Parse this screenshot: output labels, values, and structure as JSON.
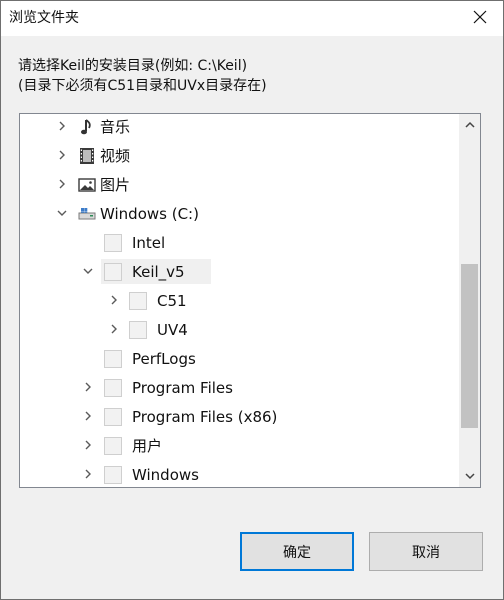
{
  "window": {
    "title": "浏览文件夹",
    "close_icon_name": "close-icon"
  },
  "instructions": {
    "line1": "请选择Keil的安装目录(例如: C:\\Keil)",
    "line2": "(目录下必须有C51目录和UVx目录存在)"
  },
  "tree": {
    "items": [
      {
        "label": "音乐",
        "expander": "chevron-right-icon",
        "icon": "music-folder-icon",
        "level": 1
      },
      {
        "label": "视频",
        "expander": "chevron-right-icon",
        "icon": "video-folder-icon",
        "level": 1
      },
      {
        "label": "图片",
        "expander": "chevron-right-icon",
        "icon": "pictures-folder-icon",
        "level": 1
      },
      {
        "label": "Windows (C:)",
        "expander": "chevron-down-icon",
        "icon": "drive-icon",
        "level": 1
      },
      {
        "label": "Intel",
        "expander": "",
        "icon": "folder-icon",
        "level": 2
      },
      {
        "label": "Keil_v5",
        "expander": "chevron-down-icon",
        "icon": "folder-icon",
        "level": 2,
        "selected": true
      },
      {
        "label": "C51",
        "expander": "chevron-right-icon",
        "icon": "folder-icon",
        "level": 3
      },
      {
        "label": "UV4",
        "expander": "chevron-right-icon",
        "icon": "folder-icon",
        "level": 3
      },
      {
        "label": "PerfLogs",
        "expander": "",
        "icon": "folder-icon",
        "level": 2
      },
      {
        "label": "Program Files",
        "expander": "chevron-right-icon",
        "icon": "folder-icon",
        "level": 2
      },
      {
        "label": "Program Files (x86)",
        "expander": "chevron-right-icon",
        "icon": "folder-icon",
        "level": 2
      },
      {
        "label": "用户",
        "expander": "chevron-right-icon",
        "icon": "folder-icon",
        "level": 2
      },
      {
        "label": "Windows",
        "expander": "chevron-right-icon",
        "icon": "folder-icon",
        "level": 2
      }
    ]
  },
  "buttons": {
    "ok": "确定",
    "cancel": "取消"
  },
  "colors": {
    "accent": "#0078d7",
    "dialog_bg": "#f0f0f0",
    "scroll_thumb": "#c2c2c2"
  }
}
